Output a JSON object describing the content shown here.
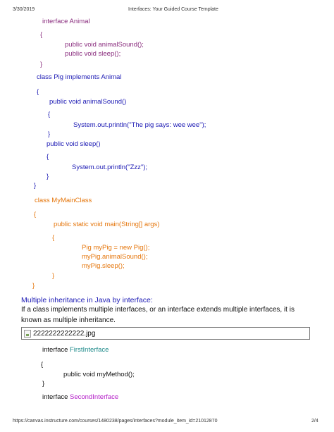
{
  "header": {
    "date": "3/30/2019",
    "title": "Interfaces: Your Guided Course Template"
  },
  "code_block_1": {
    "interface_animal": "interface Animal",
    "open_brace": "{",
    "method_animal_sound": "public void animalSound();",
    "method_sleep": "public void sleep();",
    "close_brace": "}"
  },
  "code_block_2": {
    "class_decl": "class Pig implements Animal",
    "open_brace": "{",
    "method_animal_sound": "public void animalSound()",
    "inner_open_1": "{",
    "println_wee": "System.out.println(\"The pig says: wee wee\");",
    "inner_close_1": "}",
    "method_sleep": "public void sleep()",
    "inner_open_2": "{",
    "println_zzz": "System.out.println(\"Zzz\");",
    "inner_close_2": "}",
    "close_brace": "}"
  },
  "code_block_3": {
    "class_decl": "class MyMainClass",
    "open_brace": "{",
    "main_method": "public static void main(String[] args)",
    "inner_open": "{",
    "line1": "Pig myPig = new Pig();",
    "line2": "myPig.animalSound();",
    "line3": "myPig.sleep();",
    "inner_close": "}",
    "close_brace": "}"
  },
  "section": {
    "heading": "Multiple inheritance in Java by interface:",
    "paragraph": "If a class implements multiple interfaces, or an interface extends multiple interfaces, it is known as multiple inheritance."
  },
  "image": {
    "filename": "2222222222222.jpg"
  },
  "code_block_4": {
    "interface_kw": "interface",
    "first_name": "FirstInterface",
    "open_brace": "{",
    "method": "public void myMethod();",
    "close_brace": "}",
    "interface_kw2": "interface",
    "second_name": "SecondInterface"
  },
  "footer": {
    "url": "https://canvas.instructure.com/courses/1480238/pages/interfaces?module_item_id=21012870",
    "page": "2/4"
  },
  "colors": {
    "purple": "#8a2d7e",
    "blue": "#1c1ab4",
    "orange": "#e5760c",
    "teal": "#1e8a8a",
    "magenta": "#b41ec8"
  }
}
